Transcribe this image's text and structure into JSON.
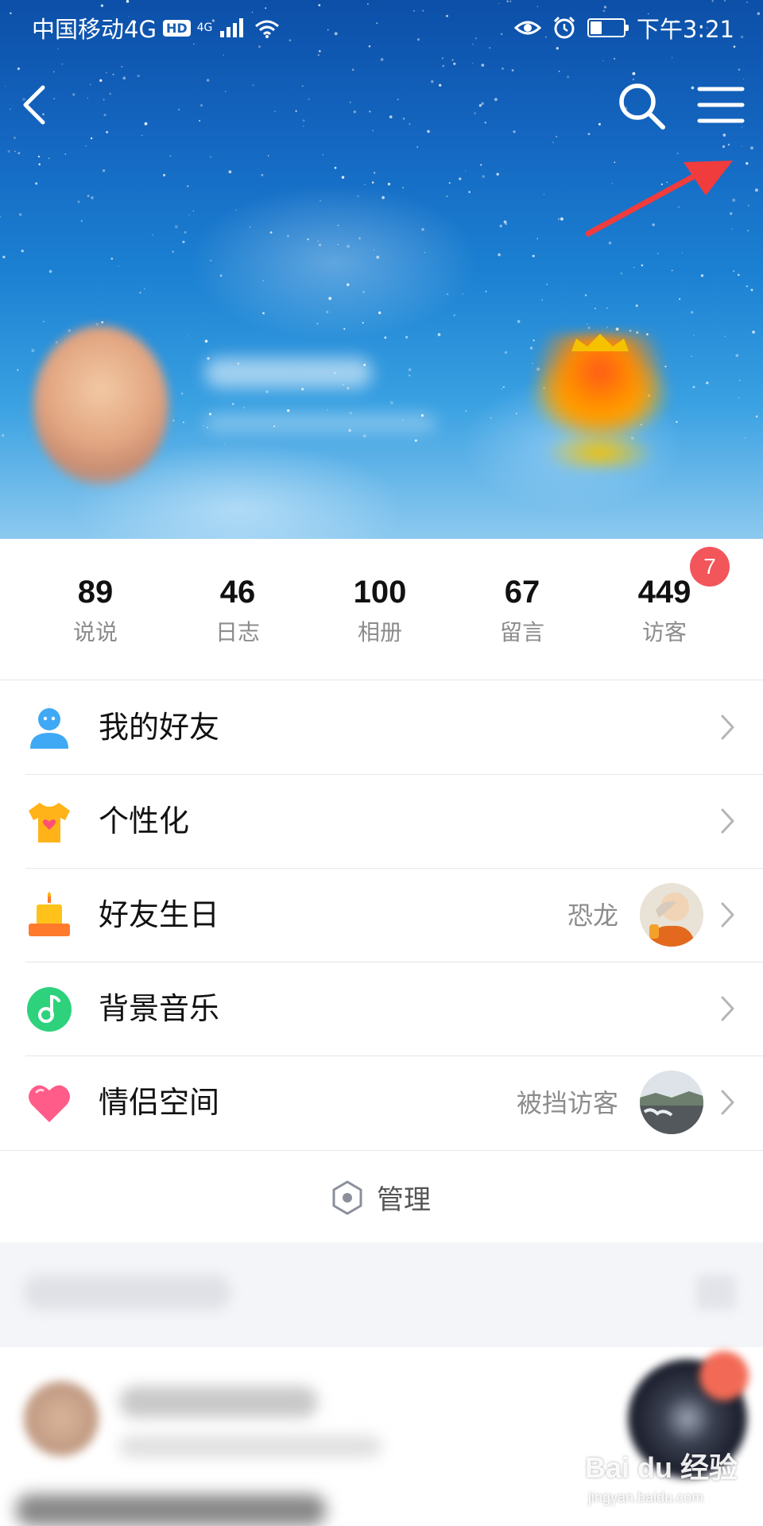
{
  "status_bar": {
    "carrier": "中国移动4G",
    "hd": "HD",
    "network": "4G",
    "time": "下午3:21"
  },
  "nav": {
    "back_icon": "chevron-left-icon",
    "search_icon": "search-icon",
    "menu_icon": "hamburger-menu-icon"
  },
  "stats": [
    {
      "count": "89",
      "label": "说说"
    },
    {
      "count": "46",
      "label": "日志"
    },
    {
      "count": "100",
      "label": "相册"
    },
    {
      "count": "67",
      "label": "留言"
    },
    {
      "count": "449",
      "label": "访客"
    }
  ],
  "visitor_badge": "7",
  "menu": [
    {
      "label": "我的好友",
      "value": "",
      "icon": "friend-icon",
      "color": "#3fa9f5"
    },
    {
      "label": "个性化",
      "value": "",
      "icon": "tshirt-icon",
      "color": "#ffb319"
    },
    {
      "label": "好友生日",
      "value": "恐龙",
      "icon": "cake-icon",
      "color": "#ff8a2a"
    },
    {
      "label": "背景音乐",
      "value": "",
      "icon": "music-icon",
      "color": "#2ed27c"
    },
    {
      "label": "情侣空间",
      "value": "被挡访客",
      "icon": "heart-icon",
      "color": "#ff5c8a"
    }
  ],
  "manage": {
    "label": "管理",
    "icon": "hexagon-settings-icon"
  },
  "watermark": {
    "top": "Bai du 经验",
    "bottom": "jingyan.baidu.com"
  },
  "colors": {
    "badge": "#f2555a",
    "hero_top": "#0c4fa8",
    "annotation_arrow": "#f03c3c"
  }
}
